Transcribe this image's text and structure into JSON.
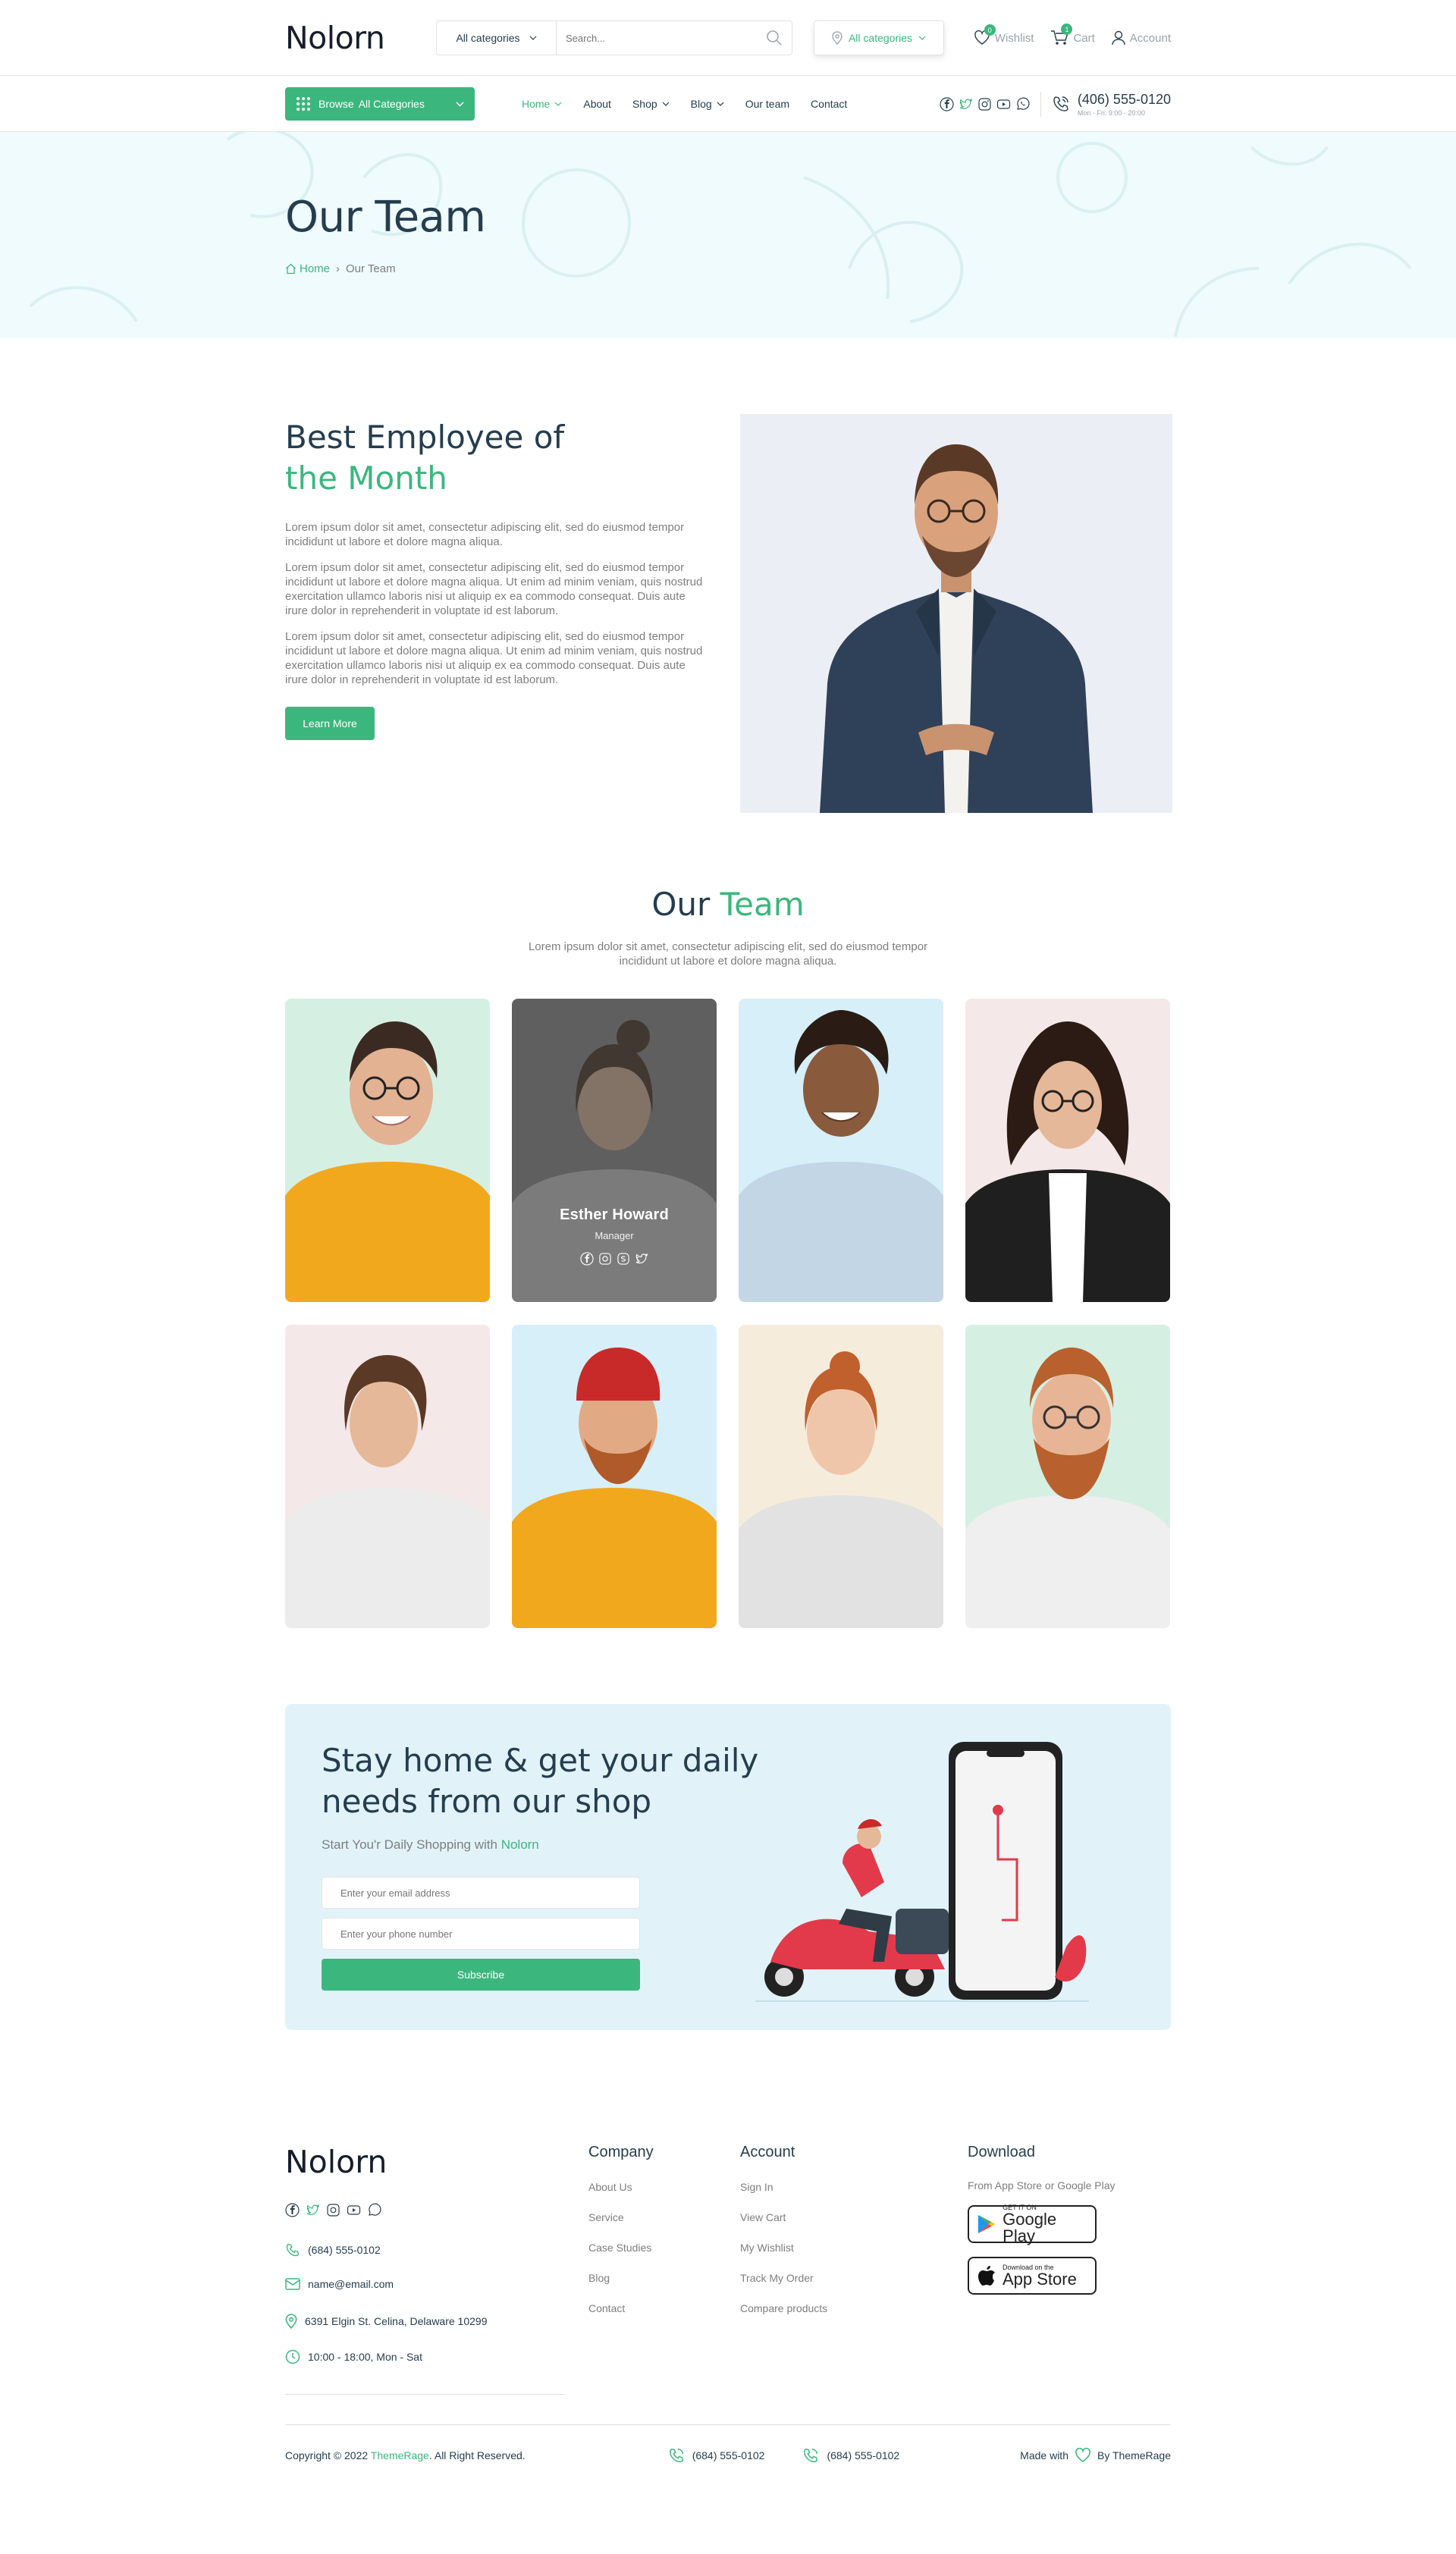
{
  "header": {
    "logo": "Nolorn",
    "search_category": "All categories",
    "search_placeholder": "Search...",
    "location_label": "All categories",
    "wishlist_label": "Wishlist",
    "wishlist_count": "0",
    "cart_label": "Cart",
    "cart_count": "1",
    "account_label": "Account"
  },
  "nav": {
    "browse_prefix": "Browse",
    "browse_label": "All Categories",
    "items": [
      {
        "label": "Home"
      },
      {
        "label": "About"
      },
      {
        "label": "Shop"
      },
      {
        "label": "Blog"
      },
      {
        "label": "Our team"
      },
      {
        "label": "Contact"
      }
    ],
    "phone": "(406) 555-0120",
    "hours": "Mon - Fri: 9:00 - 20:00"
  },
  "hero": {
    "title": "Our Team",
    "breadcrumb_home": "Home",
    "breadcrumb_current": "Our Team"
  },
  "employee": {
    "title_line1": "Best Employee of",
    "title_line2": "the Month",
    "paragraphs": [
      "Lorem ipsum dolor sit amet, consectetur adipiscing elit, sed do eiusmod tempor incididunt ut labore et dolore magna aliqua.",
      "Lorem ipsum dolor sit amet, consectetur adipiscing elit, sed do eiusmod tempor incididunt ut labore et dolore magna aliqua. Ut enim ad minim veniam, quis nostrud exercitation ullamco laboris nisi ut aliquip ex ea commodo consequat. Duis aute irure dolor in reprehenderit in voluptate id est laborum.",
      "Lorem ipsum dolor sit amet, consectetur adipiscing elit, sed do eiusmod tempor incididunt ut labore et dolore magna aliqua. Ut enim ad minim veniam, quis nostrud exercitation ullamco laboris nisi ut aliquip ex ea commodo consequat. Duis aute irure dolor in reprehenderit in voluptate id est laborum."
    ],
    "button": "Learn More"
  },
  "team": {
    "title_part1": "Our",
    "title_part2": "Team",
    "subtitle": "Lorem ipsum dolor sit amet, consectetur adipiscing elit, sed do eiusmod tempor incididunt ut labore et dolore magna aliqua.",
    "highlight_name": "Esther Howard",
    "highlight_role": "Manager"
  },
  "newsletter": {
    "title": "Stay home & get your daily needs from our shop",
    "subtitle_prefix": "Start You'r Daily Shopping with",
    "subtitle_brand": "Nolorn",
    "email_placeholder": "Enter your email address",
    "phone_placeholder": "Enter your phone number",
    "button": "Subscribe"
  },
  "footer": {
    "logo": "Nolorn",
    "phone": "(684) 555-0102",
    "email": "name@email.com",
    "address": "6391 Elgin St. Celina, Delaware 10299",
    "hours": "10:00 - 18:00, Mon - Sat",
    "company_title": "Company",
    "company_links": [
      "About Us",
      "Service",
      "Case Studies",
      "Blog",
      "Contact"
    ],
    "account_title": "Account",
    "account_links": [
      "Sign In",
      "View Cart",
      "My Wishlist",
      "Track My Order",
      "Compare products"
    ],
    "download_title": "Download",
    "download_sub": "From App Store or Google Play",
    "gplay_small": "GET IT ON",
    "gplay_big": "Google Play",
    "appstore_small": "Download on the",
    "appstore_big": "App Store"
  },
  "bottom": {
    "copyright_prefix": "Copyright © 2022",
    "copyright_brand": "ThemeRage",
    "copyright_suffix": ". All Right Reserved.",
    "phone1": "(684) 555-0102",
    "phone2": "(684) 555-0102",
    "made_with": "Made with",
    "by": "By ThemeRage"
  },
  "colors": {
    "accent": "#3bb77e",
    "dark": "#253d4e",
    "muted": "#7e7e7e",
    "hero_bg": "#effbfc",
    "newsletter_bg": "#e1f3f9"
  },
  "icons": [
    "search-icon",
    "location-icon",
    "heart-icon",
    "cart-icon",
    "user-icon",
    "grid-icon",
    "chevron-down-icon",
    "facebook-icon",
    "twitter-icon",
    "instagram-icon",
    "youtube-icon",
    "whatsapp-icon",
    "phone-icon",
    "mail-icon",
    "clock-icon",
    "home-icon",
    "google-play-icon",
    "apple-icon"
  ]
}
